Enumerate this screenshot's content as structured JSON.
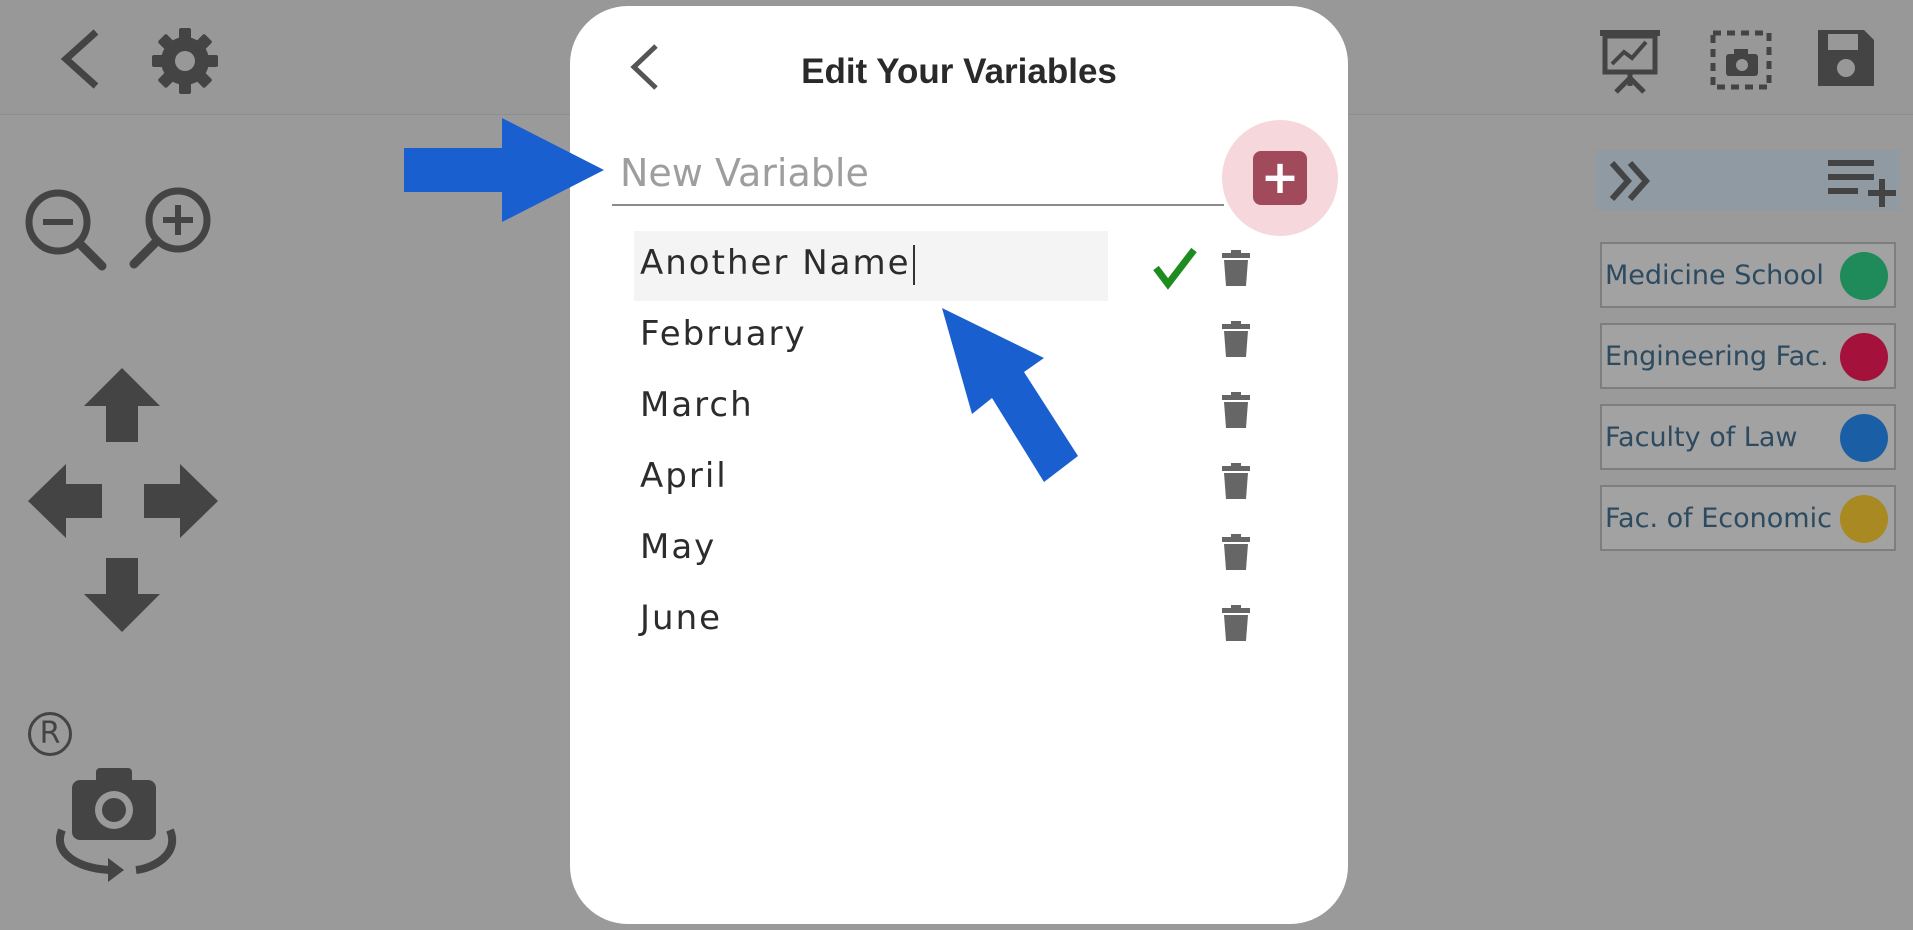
{
  "toolbar": {
    "back_icon": "chevron-left-icon",
    "settings_icon": "gear-icon",
    "presentation_icon": "presentation-chart-icon",
    "screenshot_icon": "camera-screenshot-icon",
    "save_icon": "floppy-save-icon"
  },
  "controls": {
    "zoom_out_icon": "zoom-out-icon",
    "zoom_in_icon": "zoom-in-icon",
    "move_up_icon": "arrow-up-icon",
    "move_left_icon": "arrow-left-icon",
    "move_right_icon": "arrow-right-icon",
    "move_down_icon": "arrow-down-icon",
    "registered_mark": "R",
    "rotate_camera_icon": "camera-rotate-icon"
  },
  "legend": {
    "collapse_icon": "double-chevron-right-icon",
    "add_item_icon": "playlist-add-icon",
    "items": [
      {
        "label": "Medicine School",
        "color": "#1f8a5a"
      },
      {
        "label": "Engineering Fac.",
        "color": "#a4123c"
      },
      {
        "label": "Faculty of Law",
        "color": "#1a5fa6"
      },
      {
        "label": "Fac. of Economic",
        "color": "#a98922"
      }
    ]
  },
  "modal": {
    "title": "Edit Your Variables",
    "back_icon": "chevron-left-icon",
    "new_variable_placeholder": "New Variable",
    "new_variable_value": "",
    "add_button_label": "+",
    "variables": [
      {
        "label": "Another Name",
        "editing": true
      },
      {
        "label": "February",
        "editing": false
      },
      {
        "label": "March",
        "editing": false
      },
      {
        "label": "April",
        "editing": false
      },
      {
        "label": "May",
        "editing": false
      },
      {
        "label": "June",
        "editing": false
      }
    ],
    "confirm_icon": "checkmark-icon",
    "delete_icon": "trash-icon"
  },
  "colors": {
    "backdrop": "#9a9a9a",
    "modal_bg": "#ffffff",
    "add_button": "#a04a5c",
    "add_halo": "#f6d7dc",
    "check": "#1e8c1e",
    "annotation_arrow": "#1a5fd0",
    "icon_gray": "#444444"
  }
}
